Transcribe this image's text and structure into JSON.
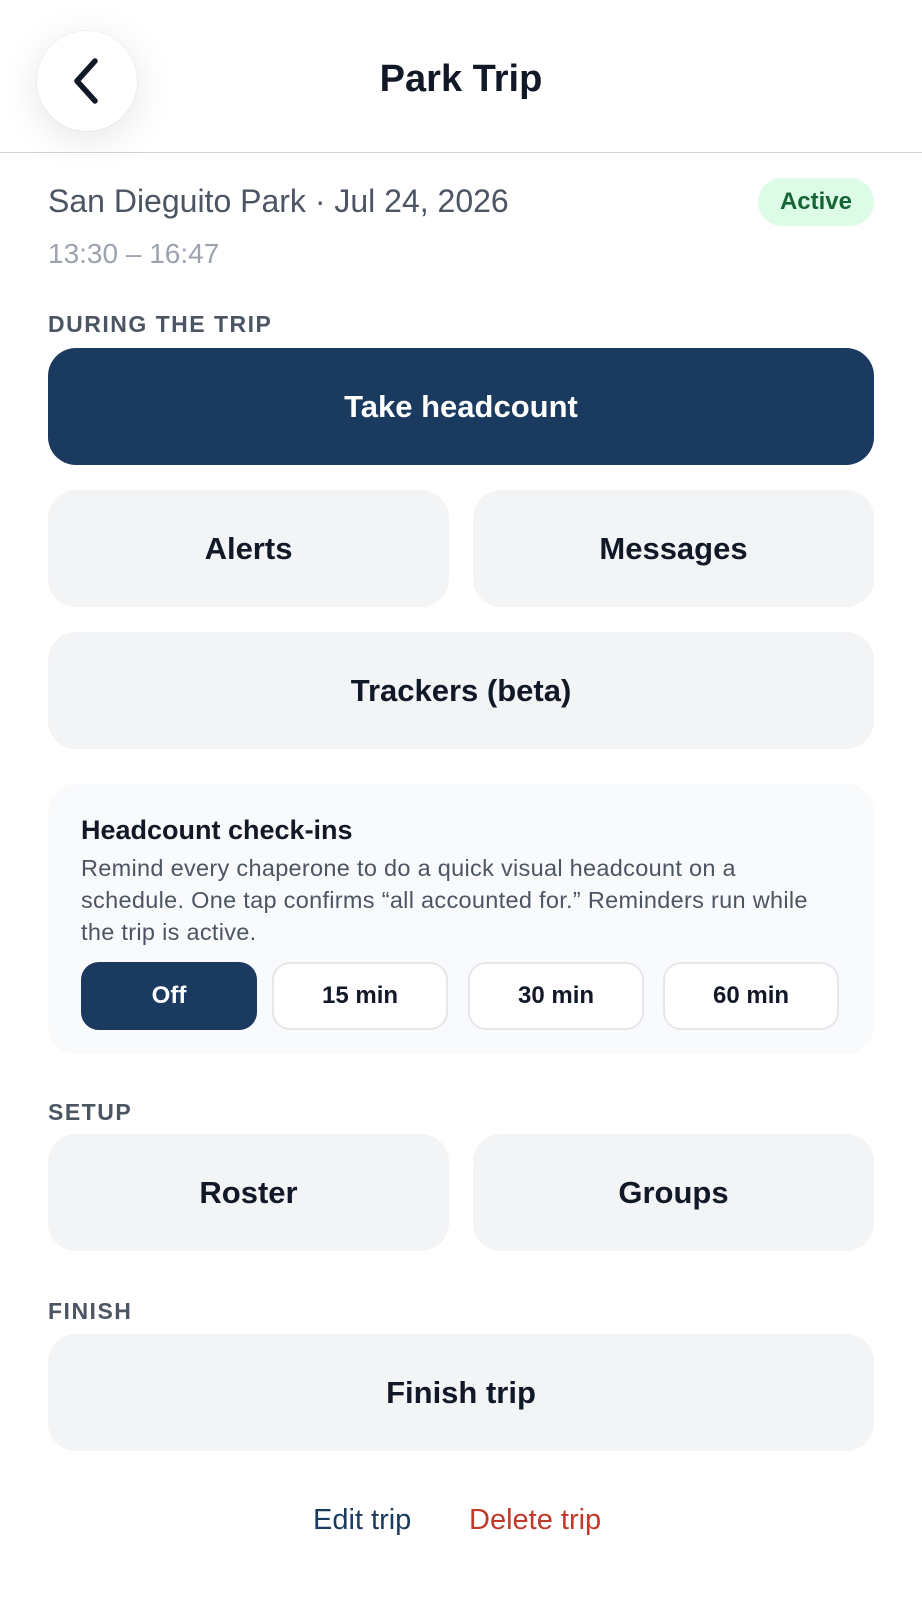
{
  "header": {
    "title": "Park Trip",
    "back_icon": "chevron-left-icon"
  },
  "trip": {
    "location_date": "San Dieguito Park · Jul 24, 2026",
    "time_range": "13:30 – 16:47",
    "status": "Active"
  },
  "sections": {
    "during": "DURING THE TRIP",
    "setup": "SETUP",
    "finish": "FINISH"
  },
  "actions": {
    "take_headcount": "Take headcount",
    "alerts": "Alerts",
    "messages": "Messages",
    "trackers": "Trackers (beta)",
    "roster": "Roster",
    "groups": "Groups",
    "finish_trip": "Finish trip"
  },
  "headcount_checkins": {
    "title": "Headcount check-ins",
    "description": "Remind every chaperone to do a quick visual headcount on a schedule. One tap confirms “all accounted for.” Reminders run while the trip is active.",
    "options": [
      "Off",
      "15 min",
      "30 min",
      "60 min"
    ],
    "selected": "Off"
  },
  "footer": {
    "edit": "Edit trip",
    "delete": "Delete trip"
  },
  "colors": {
    "primary": "#1b3a5f",
    "status_bg": "#dcfce7",
    "status_text": "#166534",
    "danger": "#c0392b",
    "button_bg": "#f3f4f6"
  }
}
